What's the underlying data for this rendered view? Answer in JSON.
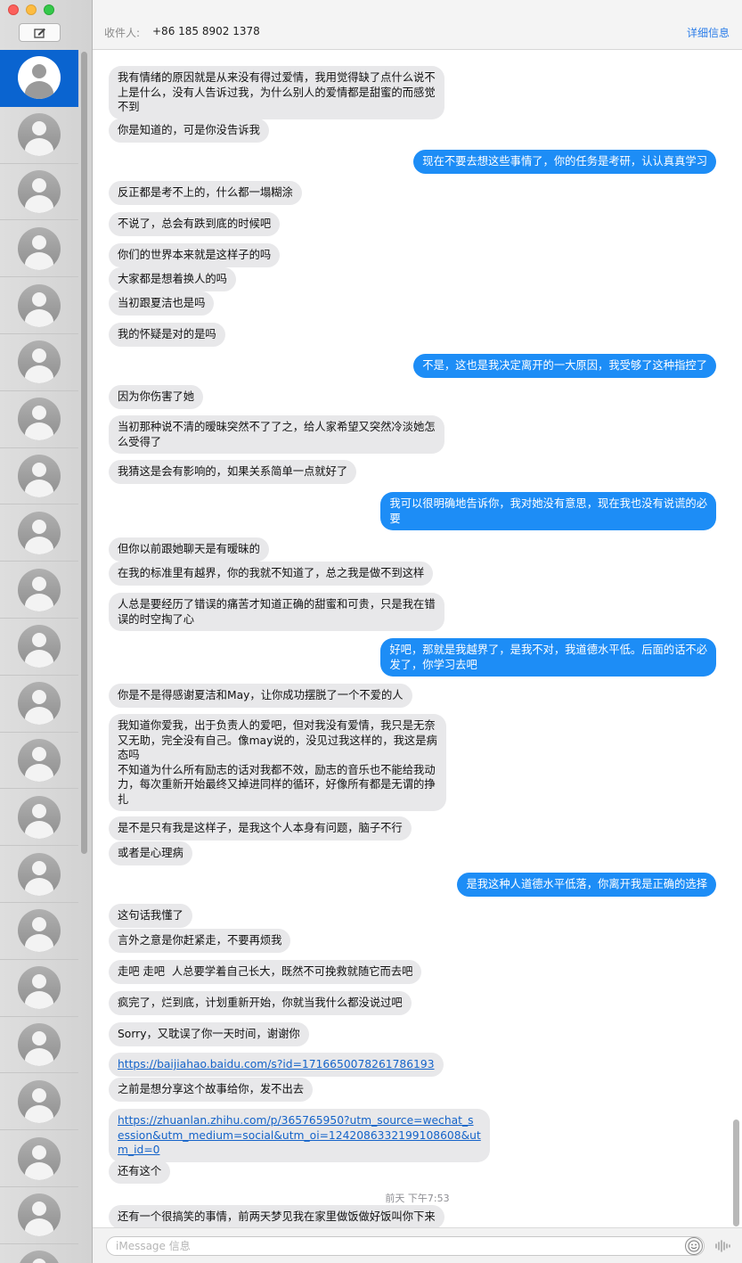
{
  "window": {
    "compose_icon": "compose-icon",
    "selected_color": "#0a64d0"
  },
  "header": {
    "to_label": "收件人:",
    "recipient": "+86 185 8902 1378",
    "details": "详细信息"
  },
  "sidebar": {
    "contacts": [
      {
        "icon": "person-avatar-icon",
        "selected": true
      },
      {
        "icon": "person-avatar-icon"
      },
      {
        "icon": "person-avatar-icon"
      },
      {
        "icon": "person-avatar-icon"
      },
      {
        "icon": "person-avatar-icon"
      },
      {
        "icon": "person-avatar-icon"
      },
      {
        "icon": "person-avatar-icon"
      },
      {
        "icon": "person-avatar-icon"
      },
      {
        "icon": "person-avatar-icon"
      },
      {
        "icon": "person-avatar-icon"
      },
      {
        "icon": "person-avatar-icon"
      },
      {
        "icon": "person-avatar-icon"
      },
      {
        "icon": "person-avatar-icon"
      },
      {
        "icon": "person-avatar-icon"
      },
      {
        "icon": "person-avatar-icon"
      },
      {
        "icon": "person-avatar-icon"
      },
      {
        "icon": "person-avatar-icon"
      },
      {
        "icon": "person-avatar-icon"
      },
      {
        "icon": "person-avatar-icon"
      },
      {
        "icon": "person-avatar-icon"
      },
      {
        "icon": "person-avatar-icon"
      },
      {
        "icon": "person-avatar-icon"
      }
    ]
  },
  "messages": [
    {
      "dir": "in",
      "text": "我有情绪的原因就是从来没有得过爱情，我用觉得缺了点什么说不\n上是什么，没有人告诉过我，为什么别人的爱情都是甜蜜的而感觉\n不到"
    },
    {
      "dir": "in",
      "text": "你是知道的，可是你没告诉我"
    },
    {
      "dir": "out",
      "text": "现在不要去想这些事情了，你的任务是考研，认认真真学习"
    },
    {
      "dir": "in",
      "text": "反正都是考不上的，什么都一塌糊涂"
    },
    {
      "dir": "in",
      "text": "不说了，总会有跌到底的时候吧"
    },
    {
      "dir": "in",
      "text": "你们的世界本来就是这样子的吗"
    },
    {
      "dir": "in",
      "text": "大家都是想着换人的吗"
    },
    {
      "dir": "in",
      "text": "当初跟夏洁也是吗"
    },
    {
      "dir": "in",
      "text": "我的怀疑是对的是吗"
    },
    {
      "dir": "out",
      "text": "不是，这也是我决定离开的一大原因，我受够了这种指控了"
    },
    {
      "dir": "in",
      "text": "因为你伤害了她"
    },
    {
      "dir": "in",
      "text": "当初那种说不清的暧昧突然不了了之，给人家希望又突然冷淡她怎\n么受得了"
    },
    {
      "dir": "in",
      "text": "我猜这是会有影响的，如果关系简单一点就好了"
    },
    {
      "dir": "out",
      "text": "我可以很明确地告诉你，我对她没有意思，现在我也没有说谎的必\n要"
    },
    {
      "dir": "in",
      "text": "但你以前跟她聊天是有暧昧的"
    },
    {
      "dir": "in",
      "text": "在我的标准里有越界，你的我就不知道了，总之我是做不到这样"
    },
    {
      "dir": "in",
      "text": "人总是要经历了错误的痛苦才知道正确的甜蜜和可贵，只是我在错\n误的时空掏了心"
    },
    {
      "dir": "out",
      "text": "好吧，那就是我越界了，是我不对，我道德水平低。后面的话不必\n发了，你学习去吧"
    },
    {
      "dir": "in",
      "text": "你是不是得感谢夏洁和May，让你成功摆脱了一个不爱的人"
    },
    {
      "dir": "in",
      "text": "我知道你爱我，出于负责人的爱吧，但对我没有爱情，我只是无奈\n又无助，完全没有自己。像may说的，没见过我这样的，我这是病\n态吗\n不知道为什么所有励志的话对我都不效，励志的音乐也不能给我动\n力，每次重新开始最终又掉进同样的循环，好像所有都是无谓的挣\n扎"
    },
    {
      "dir": "in",
      "text": "是不是只有我是这样子，是我这个人本身有问题，脑子不行"
    },
    {
      "dir": "in",
      "text": "或者是心理病"
    },
    {
      "dir": "out",
      "text": "是我这种人道德水平低落，你离开我是正确的选择"
    },
    {
      "dir": "in",
      "text": "这句话我懂了"
    },
    {
      "dir": "in",
      "text": "言外之意是你赶紧走，不要再烦我"
    },
    {
      "dir": "in",
      "text": "走吧 走吧  人总要学着自己长大，既然不可挽救就随它而去吧"
    },
    {
      "dir": "in",
      "text": "疯完了，烂到底，计划重新开始，你就当我什么都没说过吧"
    },
    {
      "dir": "in",
      "text": "Sorry，又耽误了你一天时间，谢谢你"
    },
    {
      "dir": "in",
      "link": true,
      "text": "https://baijiahao.baidu.com/s?id=1716650078261786193"
    },
    {
      "dir": "in",
      "text": "之前是想分享这个故事给你，发不出去"
    },
    {
      "dir": "in",
      "link": true,
      "text": "https://zhuanlan.zhihu.com/p/365765950?utm_source=wechat_s\nession&utm_medium=social&utm_oi=1242086332199108608&ut\nm_id=0"
    },
    {
      "dir": "in",
      "text": "还有这个"
    },
    {
      "dir": "in",
      "text": "还有一个很搞笑的事情，前两天梦见我在家里做饭做好饭叫你下来"
    }
  ],
  "timestamp": "前天 下午7:53",
  "input": {
    "placeholder": "iMessage 信息",
    "emoji_icon": "emoji-icon",
    "audio_icon": "audio-waveform-icon"
  }
}
